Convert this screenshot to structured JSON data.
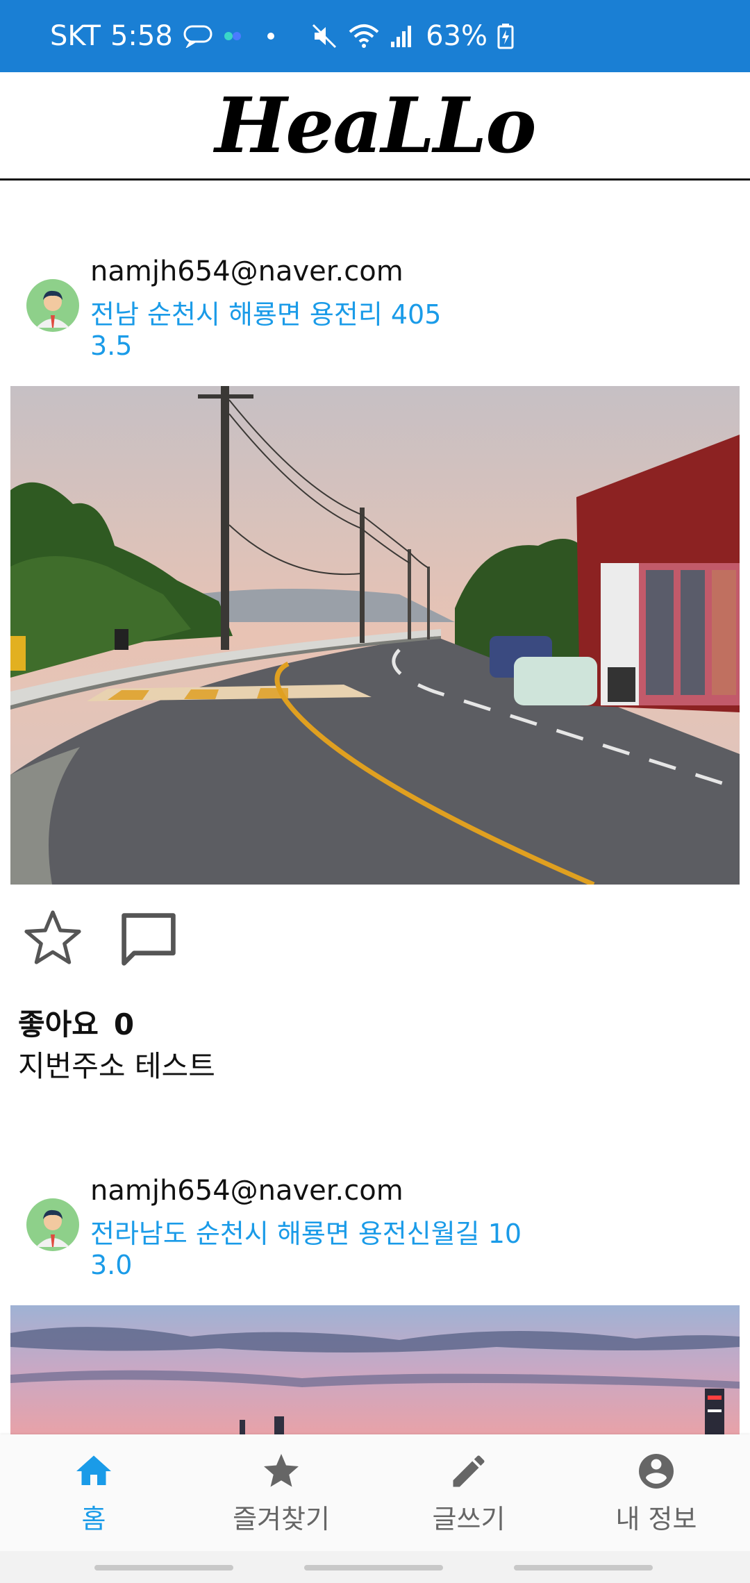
{
  "status_bar": {
    "carrier": "SKT",
    "time": "5:58",
    "battery": "63%"
  },
  "app": {
    "title": "HeaLLo"
  },
  "posts": [
    {
      "email": "namjh654@naver.com",
      "address": "전남 순천시 해룡면 용전리 405",
      "rating": "3.5",
      "likes_label": "좋아요",
      "likes_count": "0",
      "caption": "지번주소 테스트"
    },
    {
      "email": "namjh654@naver.com",
      "address": "전라남도 순천시 해룡면 용전신월길 10",
      "rating": "3.0"
    }
  ],
  "bottom_nav": {
    "items": [
      {
        "label": "홈",
        "icon": "home-icon",
        "active": true
      },
      {
        "label": "즐겨찾기",
        "icon": "star-icon",
        "active": false
      },
      {
        "label": "글쓰기",
        "icon": "pencil-icon",
        "active": false
      },
      {
        "label": "내 정보",
        "icon": "account-icon",
        "active": false
      }
    ]
  },
  "colors": {
    "status_bar_bg": "#1a7fd4",
    "accent": "#1a9be8"
  }
}
